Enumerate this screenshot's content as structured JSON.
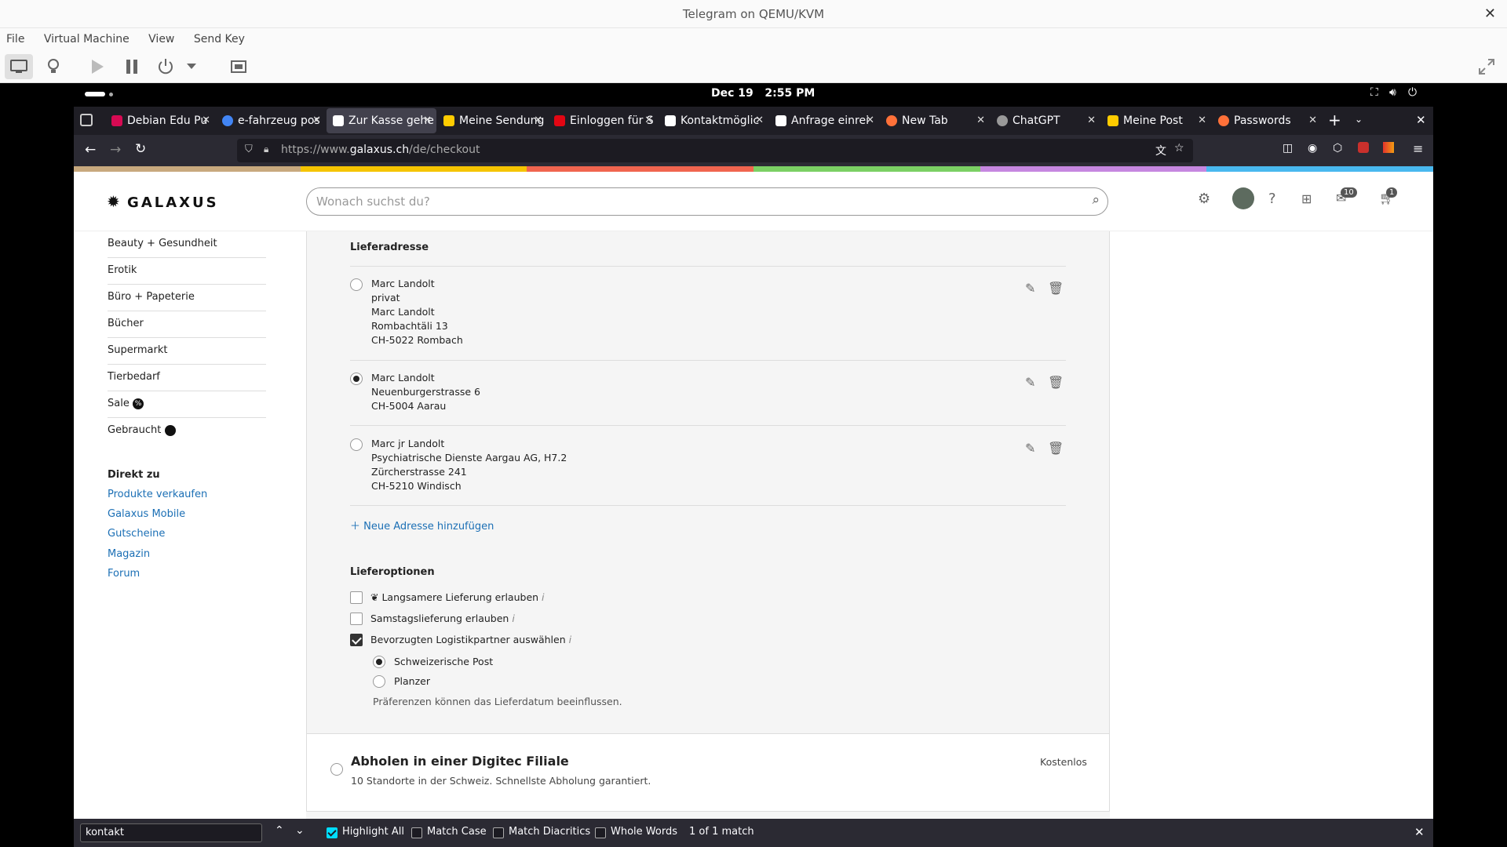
{
  "qemu": {
    "title": "Telegram on QEMU/KVM",
    "menu": [
      "File",
      "Virtual Machine",
      "View",
      "Send Key"
    ]
  },
  "gnome": {
    "date": "Dec 19",
    "time": "2:55 PM"
  },
  "tabs": [
    {
      "label": "Debian Edu Pu",
      "color": "#d70a53"
    },
    {
      "label": "e-fahrzeug pos",
      "color": "#4285f4"
    },
    {
      "label": "Zur Kasse gehe",
      "color": "#ffffff",
      "active": true
    },
    {
      "label": "Meine Sendung",
      "color": "#ffcc00"
    },
    {
      "label": "Einloggen für S",
      "color": "#e30613"
    },
    {
      "label": "Kontaktmöglic",
      "color": "#ffffff"
    },
    {
      "label": "Anfrage einrei",
      "color": "#ffffff"
    },
    {
      "label": "New Tab",
      "color": "#ff7139"
    },
    {
      "label": "ChatGPT",
      "color": "#999999"
    },
    {
      "label": "Meine Post",
      "color": "#ffcc00"
    },
    {
      "label": "Passwords",
      "color": "#ff7139"
    }
  ],
  "url": {
    "prefix": "https://www.",
    "domain": "galaxus.ch",
    "path": "/de/checkout"
  },
  "site": {
    "logo": "GALAXUS",
    "search_placeholder": "Wonach suchst du?",
    "badges": {
      "notifications": "10",
      "cart": "1"
    },
    "sidebar": {
      "categories": [
        "Beauty + Gesundheit",
        "Erotik",
        "Büro + Papeterie",
        "Bücher",
        "Supermarkt",
        "Tierbedarf",
        "Sale",
        "Gebraucht"
      ],
      "direct_heading": "Direkt zu",
      "links": [
        "Produkte verkaufen",
        "Galaxus Mobile",
        "Gutscheine",
        "Magazin",
        "Forum"
      ]
    },
    "delivery_address": {
      "heading": "Lieferadresse",
      "addresses": [
        {
          "lines": [
            "Marc Landolt",
            "privat",
            "Marc Landolt",
            "Rombachtäli 13",
            "CH-5022 Rombach"
          ],
          "selected": false
        },
        {
          "lines": [
            "Marc Landolt",
            "Neuenburgerstrasse 6",
            "CH-5004 Aarau"
          ],
          "selected": true
        },
        {
          "lines": [
            "Marc jr Landolt",
            "Psychiatrische Dienste Aargau AG, H7.2",
            "Zürcherstrasse 241",
            "CH-5210 Windisch"
          ],
          "selected": false
        }
      ],
      "add_label": "Neue Adresse hinzufügen"
    },
    "delivery_options": {
      "heading": "Lieferoptionen",
      "options": [
        {
          "label": "Langsamere Lieferung erlauben",
          "checked": false
        },
        {
          "label": "Samstagslieferung erlauben",
          "checked": false
        },
        {
          "label": "Bevorzugten Logistikpartner auswählen",
          "checked": true
        }
      ],
      "partners": [
        {
          "label": "Schweizerische Post",
          "selected": true
        },
        {
          "label": "Planzer",
          "selected": false
        }
      ],
      "note": "Präferenzen können das Lieferdatum beeinflussen."
    },
    "pickup": {
      "title": "Abholen in einer Digitec Filiale",
      "subtitle": "10 Standorte in der Schweiz. Schnellste Abholung garantiert.",
      "price": "Kostenlos"
    }
  },
  "findbar": {
    "value": "kontakt",
    "highlight_all": "Highlight All",
    "match_case": "Match Case",
    "match_diacritics": "Match Diacritics",
    "whole_words": "Whole Words",
    "result": "1 of 1 match"
  }
}
